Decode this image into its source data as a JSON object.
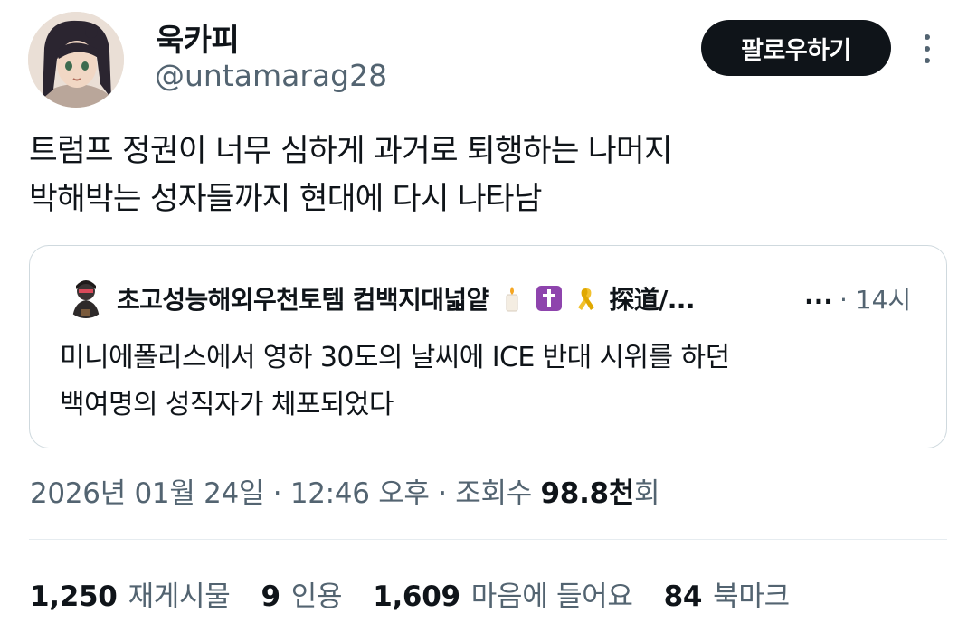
{
  "author": {
    "display_name": "욱카피",
    "handle": "@untamarag28",
    "avatar_icon": "anime-avatar"
  },
  "follow_button": {
    "label": "팔로우하기"
  },
  "more_icon": "more-vertical-icon",
  "tweet": {
    "lines": [
      "트럼프 정권이 너무 심하게 과거로 퇴행하는 나머지",
      "박해박는 성자들까지 현대에 다시 나타남"
    ]
  },
  "quote": {
    "author_name": "초고성능해외우천토템 컴백지대넓얕",
    "author_suffix": "探道/...",
    "ellipsis": "...",
    "time": "· 14시",
    "emojis": [
      "candle",
      "latin-cross",
      "yellow-ribbon"
    ],
    "lines": [
      "미니에폴리스에서 영하 30도의 날씨에 ICE 반대 시위를 하던",
      "백여명의 성직자가 체포되었다"
    ]
  },
  "meta": {
    "date_time": "2026년 01월 24일 · 12:46 오후 · 조회수 ",
    "views_value": "98.8천",
    "views_suffix": "회"
  },
  "stats": [
    {
      "value": "1,250",
      "label": "재게시물"
    },
    {
      "value": "9",
      "label": "인용"
    },
    {
      "value": "1,609",
      "label": "마음에 들어요"
    },
    {
      "value": "84",
      "label": "북마크"
    }
  ],
  "colors": {
    "text_primary": "#0f1419",
    "text_secondary": "#536471",
    "border": "#cfd9de",
    "button_bg": "#0f1419"
  }
}
